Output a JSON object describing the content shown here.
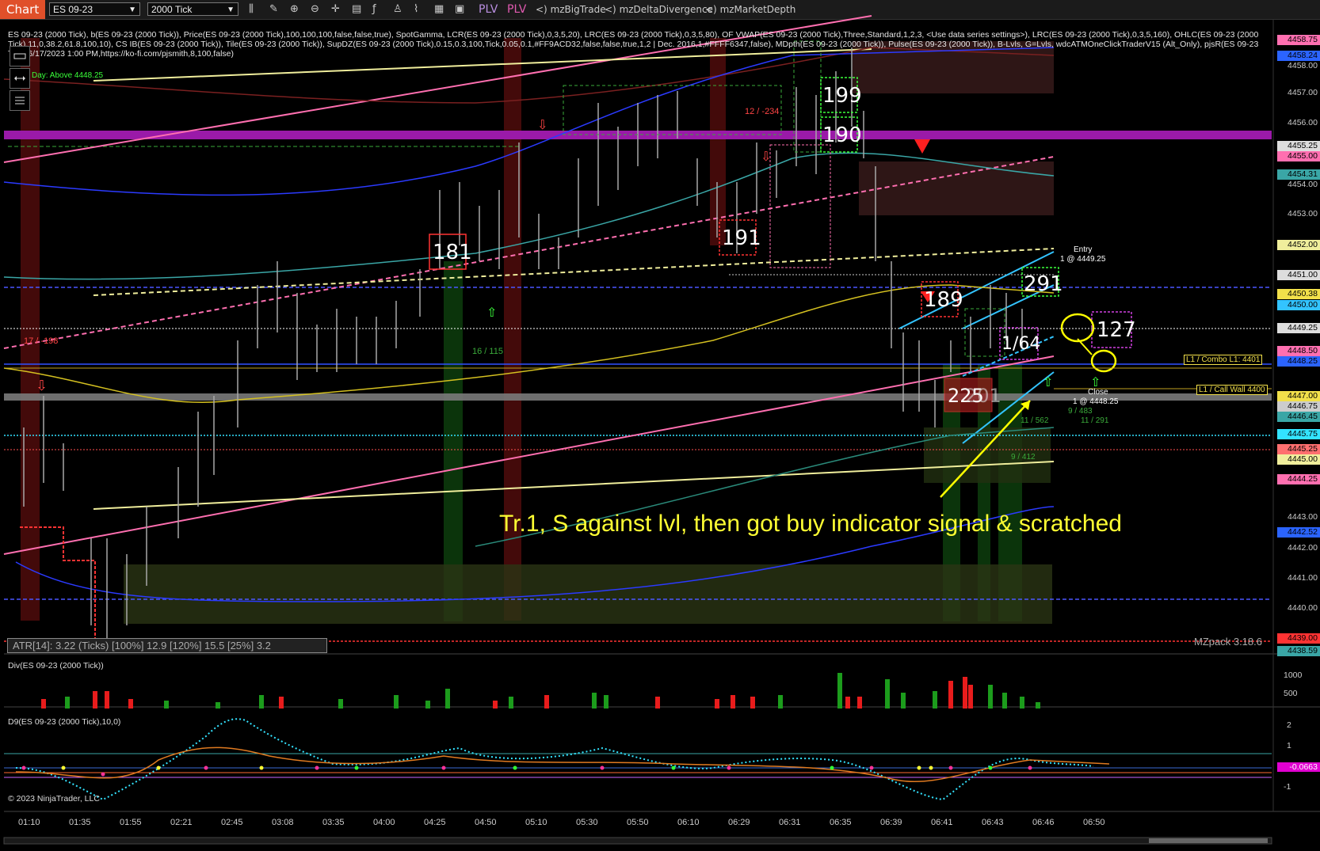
{
  "toolbar": {
    "chart_label": "Chart",
    "instrument": "ES 09-23",
    "interval": "2000 Tick",
    "plv1": "PLV",
    "plv2": "PLV",
    "link1": "mzBigTrade",
    "link2": "mzDeltaDivergence",
    "link3": "mzMarketDepth",
    "icons": [
      "bars-icon",
      "draw-icon",
      "zoom-in-icon",
      "zoom-out-icon",
      "crosshair-icon",
      "properties-icon",
      "indicators-icon",
      "strategies-icon",
      "templates-icon",
      "data-box-icon"
    ]
  },
  "header": {
    "line1": "ES 09-23 (2000 Tick), b(ES 09-23 (2000 Tick)), Price(ES 09-23 (2000 Tick),100,100,100,false,false,true), SpotGamma, LCR(ES 09-23 (2000 Tick),0,3,5,20), LRC(ES 09-23 (2000 Tick),0,3,5,80), OF VWAP(ES 09-23 (2000 Tick),Three,Standard,1,2,3, <Use data series settings>), LRC(ES 09-23 (2000 Tick),0,3,5,160), OHLC(ES 09-23 (2000",
    "line2": "Tick),11,0,38.2,61.8,100,10), CS IB(ES 09-23 (2000 Tick)), Tile(ES 09-23 (2000 Tick)), SupDZ(ES 09-23 (2000 Tick),0.15,0.3,100,Tick,0.05,0.1,#FF9ACD32,false,false,true,1,2 | Dec. 2016,1,#FFFF6347,false), MDpth(ES 09-23 (2000 Tick)), Pulse(ES 09-23 (2000 Tick)), B-Lvls, G=Lvls, wdcATMOneClickTraderV15 (Alt_Only), pjsR(ES 09-23",
    "line3": "Tick),6/17/2023 1:00 PM,https://ko-fi.com/pjsmith,8,100,false)",
    "day_above": "Day: Above 4448.25"
  },
  "annotations": {
    "main_text": "Tr.1, S against lvl, then got buy indicator signal &  scratched",
    "n181": "181",
    "n191": "191",
    "n199": "199",
    "n190": "190",
    "n189": "189",
    "n291": "291",
    "n164": "1/64",
    "n127": "127",
    "n225": "225",
    "n201": "201",
    "r12_234": "12 / -234",
    "r17_198": "17 / -198",
    "r16_115": "16 / 115",
    "entry": "Entry",
    "entry_fill": "1 @ 4449.25",
    "close": "Close",
    "close_fill": "1 @ 4448.25",
    "r11_562": "11 / 562",
    "r9_483": "9 / 483",
    "r11_291": "11 / 291",
    "r9_412": "9 / 412",
    "combo": "L1 / Combo L1: 4401",
    "callwall": "L1 / Call Wall 4400",
    "atr": "ATR[14]: 3.22 (Ticks) [100%] 12.9  [120%] 15.5  [25%] 3.2",
    "mzpack": "MZpack 3.18.6"
  },
  "div_panel": {
    "title": "Div(ES 09-23 (2000 Tick))",
    "y1000": "1000",
    "y500": "500"
  },
  "d9_panel": {
    "title": "D9(ES 09-23 (2000 Tick),10,0)",
    "y2": "2",
    "y1": "1",
    "ym1": "-1",
    "value": "-0.0663",
    "copyright": "© 2023 NinjaTrader, LLC"
  },
  "price_labels": [
    {
      "v": "4458.75",
      "bg": "#ff6fb0"
    },
    {
      "v": "4458.24",
      "bg": "#2b64ff"
    },
    {
      "v": "4458.00",
      "bg": ""
    },
    {
      "v": "4457.00",
      "bg": ""
    },
    {
      "v": "4456.00",
      "bg": ""
    },
    {
      "v": "4455.25",
      "bg": "#dddddd"
    },
    {
      "v": "4455.00",
      "bg": "#ff6fb0"
    },
    {
      "v": "4454.31",
      "bg": "#3aa6a6"
    },
    {
      "v": "4454.00",
      "bg": ""
    },
    {
      "v": "4453.00",
      "bg": ""
    },
    {
      "v": "4452.00",
      "bg": "#f0ee9c"
    },
    {
      "v": "4451.00",
      "bg": "#dddddd"
    },
    {
      "v": "4450.38",
      "bg": "#f2e04a"
    },
    {
      "v": "4450.00",
      "bg": "#33c4ff"
    },
    {
      "v": "4449.25",
      "bg": "#dddddd"
    },
    {
      "v": "4448.50",
      "bg": "#ff6fb0"
    },
    {
      "v": "4448.25",
      "bg": "#2b64ff"
    },
    {
      "v": "4447.00",
      "bg": "#f2e04a"
    },
    {
      "v": "4446.75",
      "bg": "#cccccc"
    },
    {
      "v": "4446.45",
      "bg": "#3aa6a6"
    },
    {
      "v": "4445.75",
      "bg": "#33e3ff"
    },
    {
      "v": "4445.25",
      "bg": "#ff6f6f"
    },
    {
      "v": "4445.00",
      "bg": "#f0ee9c"
    },
    {
      "v": "4444.25",
      "bg": "#ff6fb0"
    },
    {
      "v": "4443.00",
      "bg": ""
    },
    {
      "v": "4442.52",
      "bg": "#2b64ff"
    },
    {
      "v": "4442.00",
      "bg": ""
    },
    {
      "v": "4441.00",
      "bg": ""
    },
    {
      "v": "4440.00",
      "bg": ""
    },
    {
      "v": "4439.00",
      "bg": "#ff3333"
    },
    {
      "v": "4438.59",
      "bg": "#3aa6a6"
    }
  ],
  "time_labels": [
    "01:10",
    "01:35",
    "01:55",
    "02:21",
    "02:45",
    "03:08",
    "03:35",
    "04:00",
    "04:25",
    "04:50",
    "05:10",
    "05:30",
    "05:50",
    "06:10",
    "06:29",
    "06:31",
    "06:35",
    "06:39",
    "06:41",
    "06:43",
    "06:46",
    "06:50"
  ]
}
